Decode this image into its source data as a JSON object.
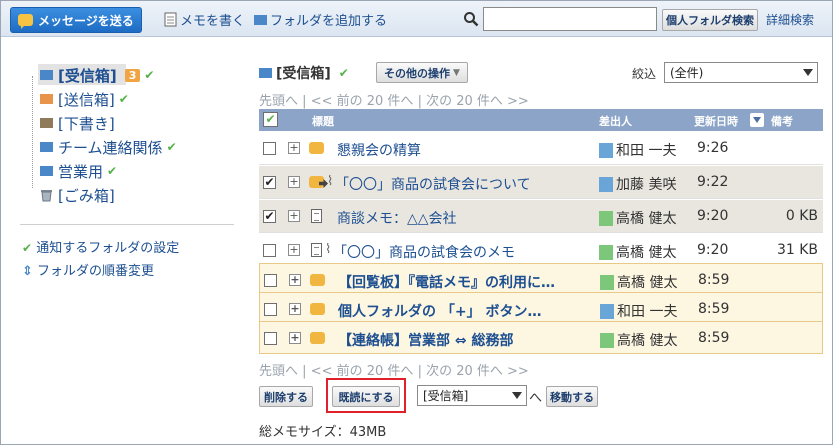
{
  "toolbar": {
    "send_label": "メッセージを送る",
    "memo_label": "メモを書く",
    "add_folder_label": "フォルダを追加する",
    "search_value": "",
    "search_button": "個人フォルダ検索",
    "advanced_search": "詳細検索"
  },
  "sidebar": {
    "items": [
      {
        "label": "[受信箱]",
        "badge": "3",
        "icon": "folder-blue-icon",
        "checked": true,
        "selected": true
      },
      {
        "label": "[送信箱]",
        "icon": "folder-orange-icon",
        "checked": true
      },
      {
        "label": "[下書き]",
        "icon": "folder-brown-icon",
        "checked": false
      },
      {
        "label": "チーム連絡関係",
        "icon": "folder-blue-icon",
        "checked": true
      },
      {
        "label": "営業用",
        "icon": "folder-blue-icon",
        "checked": true
      },
      {
        "label": "[ごみ箱]",
        "icon": "trash-icon",
        "checked": false
      }
    ],
    "notify_settings": "通知するフォルダの設定",
    "reorder": "フォルダの順番変更"
  },
  "main": {
    "title": "[受信箱]",
    "other_ops": "その他の操作",
    "filter_label": "絞込",
    "filter_value": "(全件)",
    "pager": {
      "first": "先頭へ",
      "prev": "<< 前の 20 件へ",
      "next": "次の 20 件へ >>",
      "sep": "|"
    },
    "columns": {
      "subject": "標題",
      "sender": "差出人",
      "updated": "更新日時",
      "note": "備考"
    },
    "rows": [
      {
        "subject": "懇親会の精算",
        "sender": "和田 一夫",
        "time": "9:26",
        "size": "",
        "checked": false,
        "type": "message",
        "unread": false,
        "notice": false,
        "sender_color": "blue"
      },
      {
        "subject": "「〇〇」商品の試食会について",
        "sender": "加藤 美咲",
        "time": "9:22",
        "size": "",
        "checked": true,
        "type": "message-forward-clip",
        "unread": false,
        "notice": false,
        "sender_color": "blue"
      },
      {
        "subject": "商談メモ：△△会社",
        "sender": "高橋 健太",
        "time": "9:20",
        "size": "0 KB",
        "checked": true,
        "type": "memo",
        "unread": false,
        "notice": false,
        "sender_color": "green"
      },
      {
        "subject": "「〇〇」商品の試食会のメモ",
        "sender": "高橋 健太",
        "time": "9:20",
        "size": "31 KB",
        "checked": false,
        "type": "memo-clip",
        "unread": false,
        "notice": false,
        "sender_color": "green"
      },
      {
        "subject": "【回覧板】『電話メモ』の利用に…",
        "sender": "高橋 健太",
        "time": "8:59",
        "size": "",
        "checked": false,
        "type": "message",
        "unread": true,
        "notice": true,
        "sender_color": "green"
      },
      {
        "subject": "個人フォルダの 「+」 ボタン…",
        "sender": "和田 一夫",
        "time": "8:59",
        "size": "",
        "checked": false,
        "type": "message",
        "unread": true,
        "notice": true,
        "sender_color": "blue"
      },
      {
        "subject": "【連絡帳】営業部 ⇔ 総務部",
        "sender": "高橋 健太",
        "time": "8:59",
        "size": "",
        "checked": false,
        "type": "message",
        "unread": true,
        "notice": true,
        "sender_color": "green"
      }
    ],
    "delete_button": "削除する",
    "mark_read_button": "既読にする",
    "move_target": "[受信箱]",
    "move_suffix": "へ",
    "move_button": "移動する",
    "total_size": "総メモサイズ：43MB"
  },
  "colors": {
    "link": "#1d4f91",
    "header": "#8ba4c7",
    "send_button": "#1d6cc4",
    "highlight": "#e0202a",
    "check": "#56b14a"
  }
}
